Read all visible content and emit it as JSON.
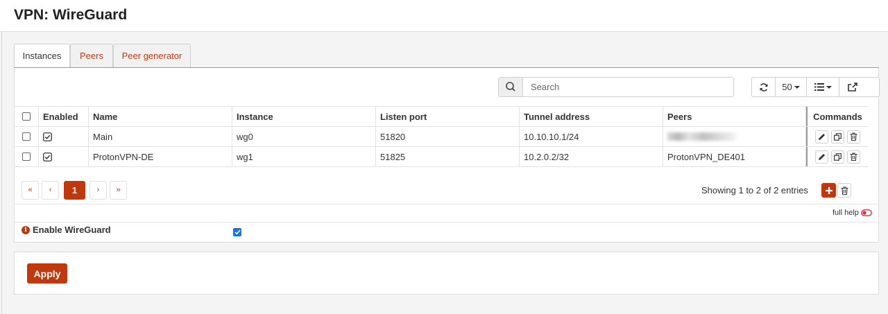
{
  "header": {
    "title": "VPN: WireGuard"
  },
  "tabs": [
    {
      "label": "Instances",
      "active": true
    },
    {
      "label": "Peers",
      "active": false
    },
    {
      "label": "Peer generator",
      "active": false
    }
  ],
  "toolbar": {
    "search_placeholder": "Search",
    "page_size": "50"
  },
  "table": {
    "columns": [
      "Enabled",
      "Name",
      "Instance",
      "Listen port",
      "Tunnel address",
      "Peers",
      "Commands"
    ],
    "rows": [
      {
        "enabled": true,
        "name": "Main",
        "instance": "wg0",
        "listen_port": "51820",
        "tunnel_address": "10.10.10.1/24",
        "peers": "",
        "peers_redacted": true
      },
      {
        "enabled": true,
        "name": "ProtonVPN-DE",
        "instance": "wg1",
        "listen_port": "51825",
        "tunnel_address": "10.2.0.2/32",
        "peers": "ProtonVPN_DE401",
        "peers_redacted": false
      }
    ]
  },
  "pagination": {
    "first": "«",
    "prev": "‹",
    "current": "1",
    "next": "›",
    "last": "»",
    "summary": "Showing 1 to 2 of 2 entries"
  },
  "full_help_label": "full help",
  "settings": {
    "enable_label": "Enable WireGuard",
    "enable_checked": true
  },
  "apply_label": "Apply",
  "colors": {
    "accent": "#c0390e",
    "checkbox_blue": "#1a73e8"
  }
}
